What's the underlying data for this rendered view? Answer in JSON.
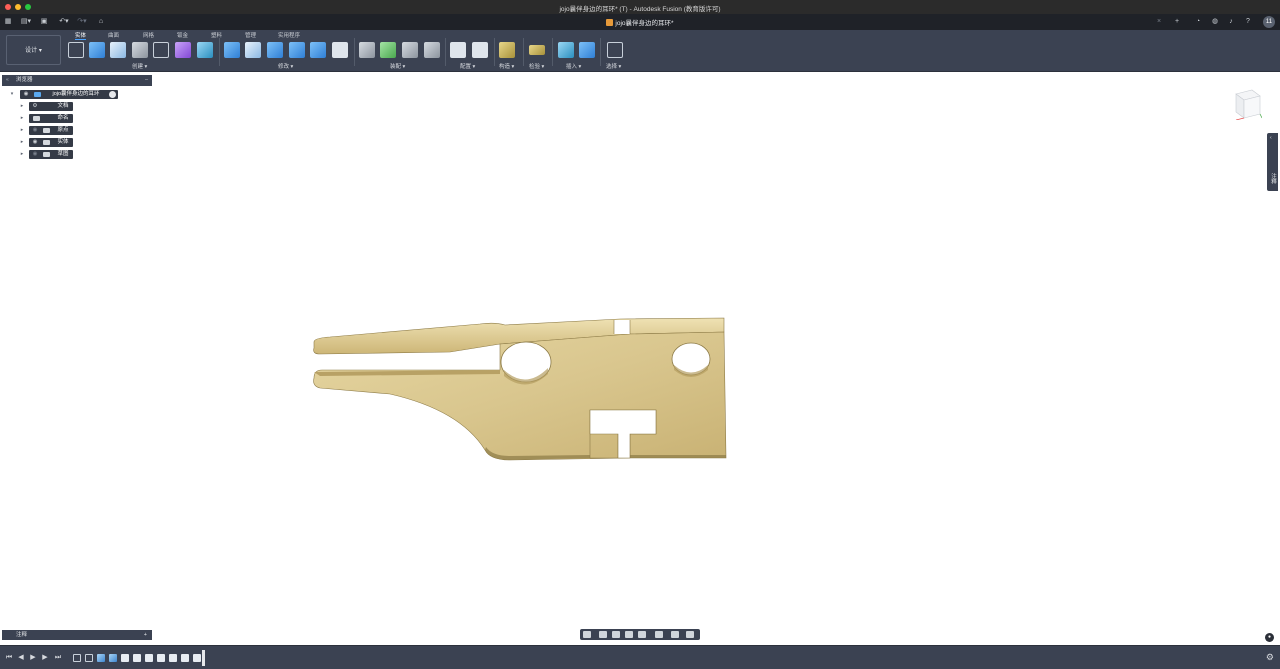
{
  "window": {
    "title": "jojo曩伴身边的耳环* (T) - Autodesk Fusion (教育版许可)"
  },
  "tabbar": {
    "doc_tab_label": "jojo曩伴身边的耳环*",
    "user_initials": "11"
  },
  "toolbar": {
    "workspace": "设计 ▾",
    "workspace_tabs": [
      "实体",
      "曲面",
      "网格",
      "钣金",
      "塑料",
      "管理",
      "实用程序"
    ],
    "group_labels": {
      "create": "创建 ▾",
      "modify": "修改 ▾",
      "assemble": "装配 ▾",
      "configure": "配置 ▾",
      "construct": "构造 ▾",
      "inspect": "检验 ▾",
      "insert": "插入 ▾",
      "select": "选择 ▾"
    }
  },
  "browser": {
    "title": "浏览器",
    "root": "jojo曩伴身边的耳环",
    "items": [
      {
        "label": "文档设置",
        "icon": "gear-icon"
      },
      {
        "label": "命名视图",
        "icon": "folder-icon"
      },
      {
        "label": "原点",
        "icon": "folder-icon"
      },
      {
        "label": "实体",
        "icon": "folder-icon"
      },
      {
        "label": "草图",
        "icon": "folder-icon"
      }
    ]
  },
  "side_panel": {
    "label": "注释"
  },
  "notes": {
    "label": "注释"
  },
  "colors": {
    "toolbar_bg": "#3b4252",
    "titlebar_bg": "#2b2b2b",
    "model_gold": "#d8c58f",
    "accent_blue": "#4aa3ff"
  }
}
